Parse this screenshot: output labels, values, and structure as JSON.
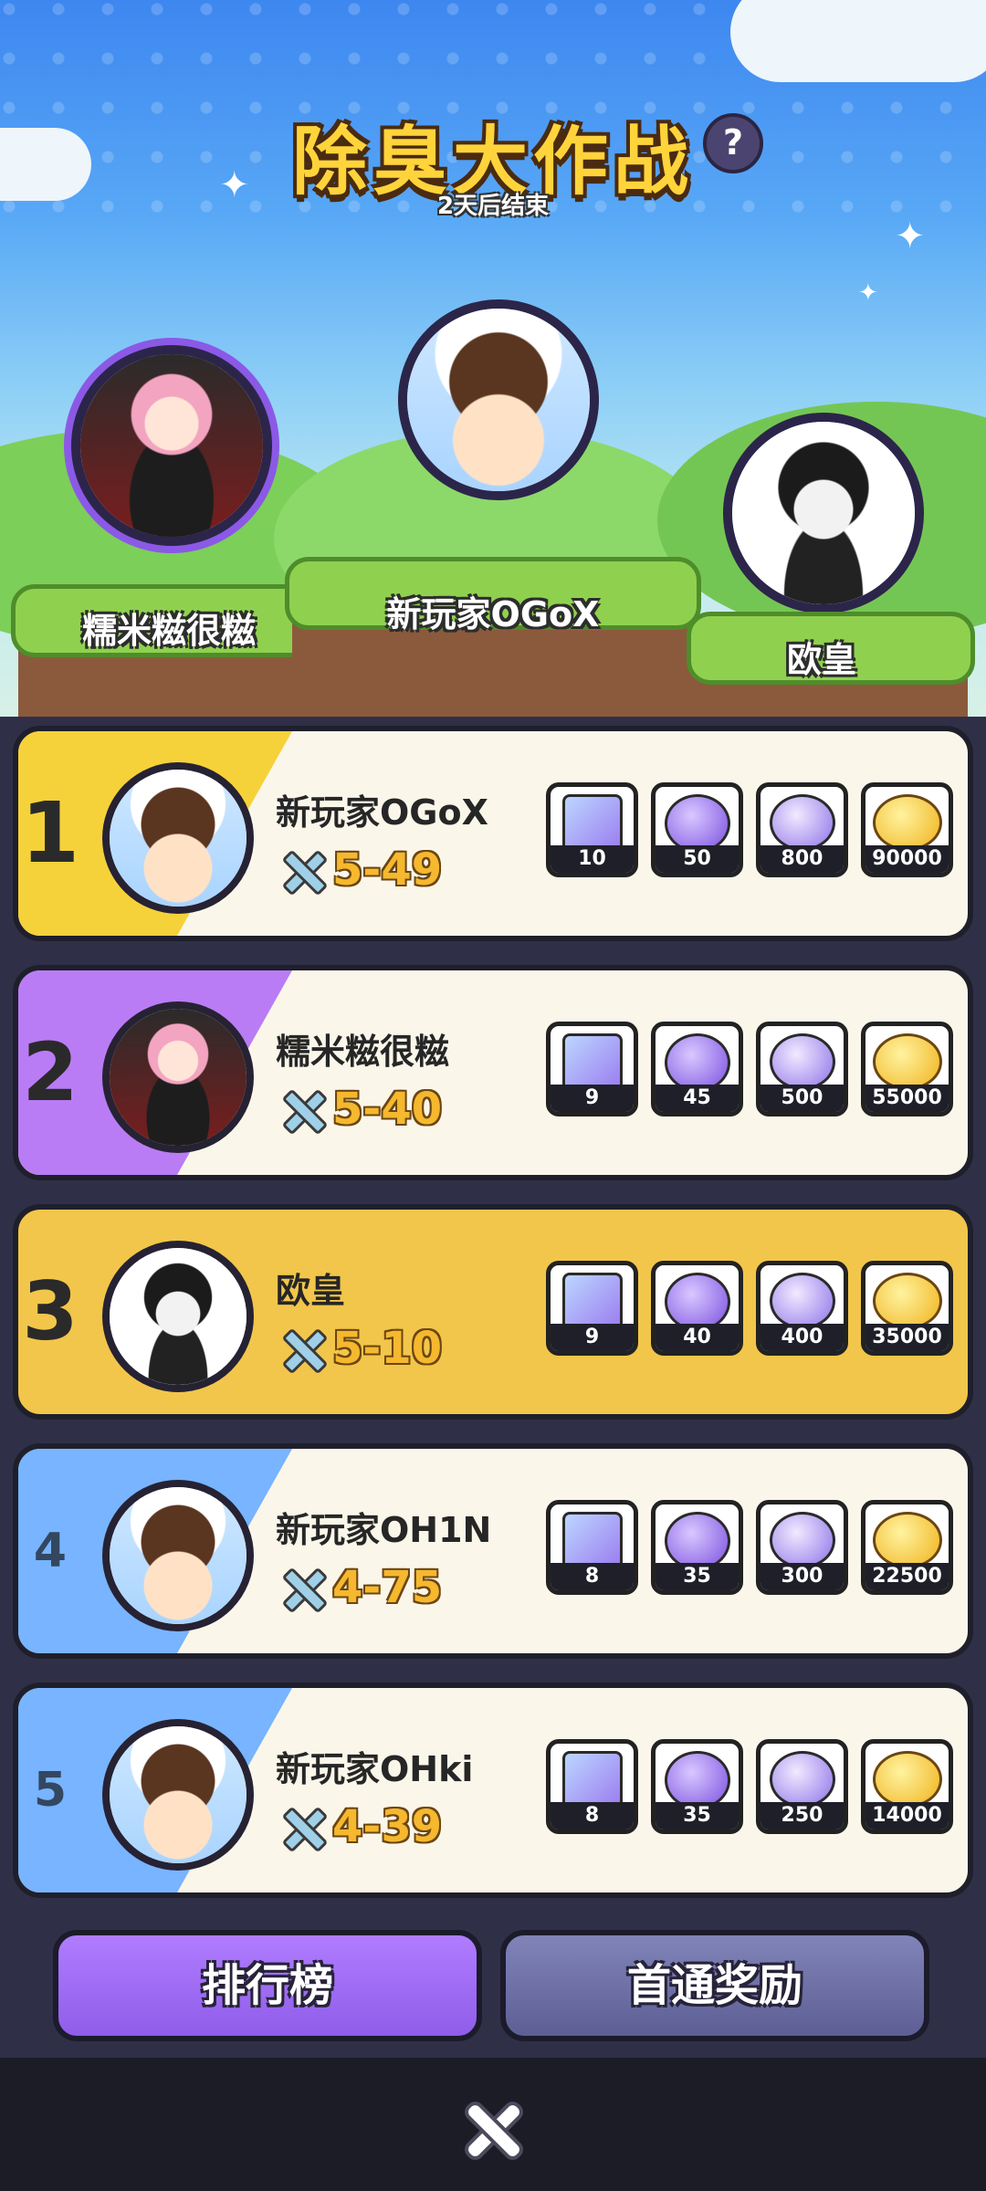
{
  "event": {
    "title": "除臭大作战",
    "help_icon": "?",
    "subtitle": "2天后结束"
  },
  "podium": {
    "first": {
      "name": "新玩家OGoX"
    },
    "second": {
      "name": "糯米糍很糍"
    },
    "third": {
      "name": "欧皇"
    }
  },
  "leaderboard": [
    {
      "rank": "1",
      "name": "新玩家OGoX",
      "score": "5-49",
      "rewards": [
        "10",
        "50",
        "800",
        "90000"
      ],
      "band_color": "#f5d23a"
    },
    {
      "rank": "2",
      "name": "糯米糍很糍",
      "score": "5-40",
      "rewards": [
        "9",
        "45",
        "500",
        "55000"
      ],
      "band_color": "#b97cf5"
    },
    {
      "rank": "3",
      "name": "欧皇",
      "score": "5-10",
      "rewards": [
        "9",
        "40",
        "400",
        "35000"
      ],
      "band_color": "#eec24a"
    },
    {
      "rank": "4",
      "name": "新玩家OH1N",
      "score": "4-75",
      "rewards": [
        "8",
        "35",
        "300",
        "22500"
      ],
      "band_color": "#78b4ff"
    },
    {
      "rank": "5",
      "name": "新玩家OHki",
      "score": "4-39",
      "rewards": [
        "8",
        "35",
        "250",
        "14000"
      ],
      "band_color": "#78b4ff"
    }
  ],
  "tabs": {
    "leaderboard": "排行榜",
    "first_clear_rewards": "首通奖励"
  },
  "reward_icons": [
    "mystery-box-icon",
    "pet-egg-icon",
    "orb-icon",
    "coin-icon"
  ]
}
